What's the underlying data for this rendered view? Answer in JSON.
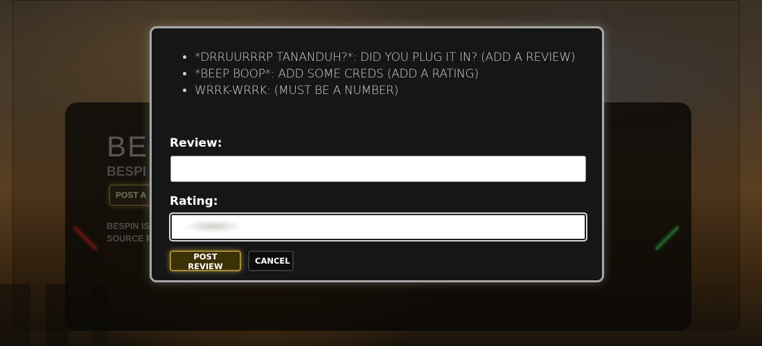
{
  "background": {
    "card": {
      "title": "BES",
      "subtitle": "BESPI",
      "button_label": "POST A",
      "description": "BESPIN IS ... WHICH ME... ACTUALLY ... ENTERPR... TO HARVE... SOURCE FOR STARSHIPS AND THEIR HYPERDRIVES."
    }
  },
  "modal": {
    "errors": [
      "*DRRUURRRP TANANDUH?*: DID YOU PLUG IT IN? (ADD A REVIEW)",
      "*BEEP BOOP*: ADD SOME CREDS (ADD A RATING)",
      "WRRK-WRRK: (MUST BE A NUMBER)"
    ],
    "review": {
      "label": "Review:",
      "value": "",
      "placeholder": ""
    },
    "rating": {
      "label": "Rating:",
      "value": "",
      "placeholder": ""
    },
    "post_label": "POST REVIEW",
    "cancel_label": "CANCEL"
  },
  "colors": {
    "accent_gold": "#a58d3c",
    "modal_bg": "#161616",
    "modal_border": "#a9a9a9"
  }
}
